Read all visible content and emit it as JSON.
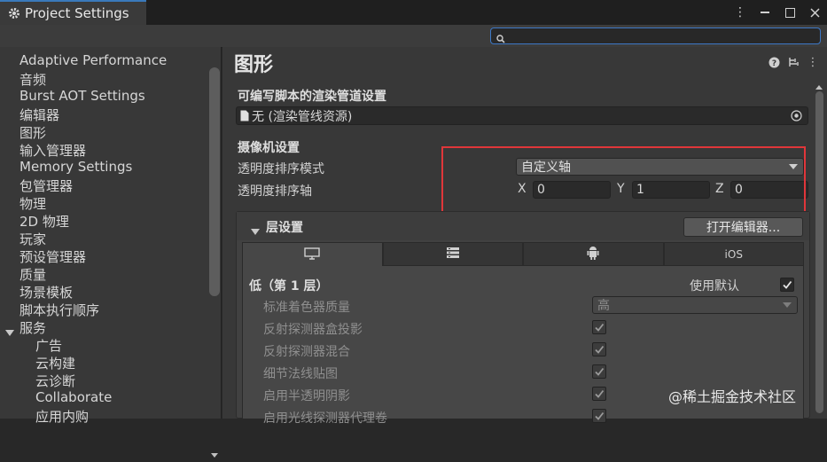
{
  "window": {
    "title": "Project Settings"
  },
  "sidebar": {
    "items": [
      {
        "label": "Adaptive Performance"
      },
      {
        "label": "音频"
      },
      {
        "label": "Burst AOT Settings"
      },
      {
        "label": "编辑器"
      },
      {
        "label": "图形",
        "selected": true
      },
      {
        "label": "输入管理器"
      },
      {
        "label": "Memory Settings"
      },
      {
        "label": "包管理器"
      },
      {
        "label": "物理"
      },
      {
        "label": "2D 物理"
      },
      {
        "label": "玩家"
      },
      {
        "label": "预设管理器"
      },
      {
        "label": "质量"
      },
      {
        "label": "场景模板"
      },
      {
        "label": "脚本执行顺序"
      },
      {
        "label": "服务",
        "expanded": true
      },
      {
        "label": "广告",
        "child": true
      },
      {
        "label": "云构建",
        "child": true
      },
      {
        "label": "云诊断",
        "child": true
      },
      {
        "label": "Collaborate",
        "child": true
      },
      {
        "label": "应用内购",
        "child": true
      }
    ]
  },
  "main": {
    "title": "图形",
    "srp_heading": "可编写脚本的渲染管道设置",
    "srp_value": "无 (渲染管线资源)",
    "camera_heading": "摄像机设置",
    "sort_mode_label": "透明度排序模式",
    "sort_mode_value": "自定义轴",
    "sort_axis_label": "透明度排序轴",
    "axis": {
      "x_label": "X",
      "x": "0",
      "y_label": "Y",
      "y": "1",
      "z_label": "Z",
      "z": "0"
    }
  },
  "tiers": {
    "header": "层设置",
    "open_editor": "打开编辑器...",
    "platform_tabs": [
      {
        "icon": "monitor-icon"
      },
      {
        "icon": "server-icon"
      },
      {
        "icon": "android-icon"
      },
      {
        "label": "iOS"
      }
    ],
    "tier_title": "低（第 1 层）",
    "use_defaults": "使用默认",
    "rows": [
      {
        "label": "标准着色器质量",
        "value": "高",
        "type": "dropdown"
      },
      {
        "label": "反射探测器盒投影",
        "type": "checkbox"
      },
      {
        "label": "反射探测器混合",
        "type": "checkbox"
      },
      {
        "label": "细节法线贴图",
        "type": "checkbox"
      },
      {
        "label": "启用半透明阴影",
        "type": "checkbox"
      },
      {
        "label": "启用光线探测器代理卷",
        "type": "checkbox"
      }
    ]
  },
  "watermark": "@稀土掘金技术社区",
  "colors": {
    "accent": "#3d78c6",
    "highlight_box": "#e0363a"
  }
}
